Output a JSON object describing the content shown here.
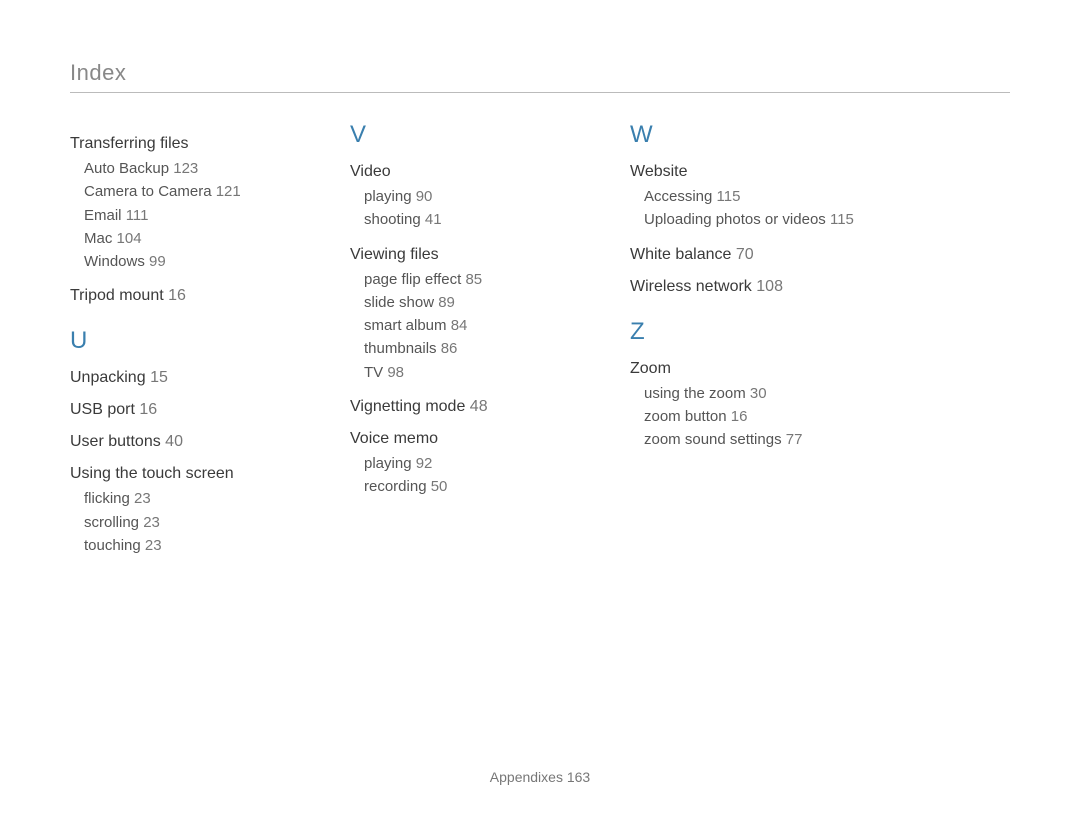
{
  "header": "Index",
  "col1": {
    "transferring": {
      "title": "Transferring files",
      "items": [
        {
          "label": "Auto Backup",
          "page": "123"
        },
        {
          "label": "Camera to Camera",
          "page": "121"
        },
        {
          "label": "Email",
          "page": "111"
        },
        {
          "label": "Mac",
          "page": "104"
        },
        {
          "label": "Windows",
          "page": "99"
        }
      ]
    },
    "tripod": {
      "label": "Tripod mount",
      "page": "16"
    },
    "letter": "U",
    "unpacking": {
      "label": "Unpacking",
      "page": "15"
    },
    "usbport": {
      "label": "USB port",
      "page": "16"
    },
    "userbuttons": {
      "label": "User buttons",
      "page": "40"
    },
    "touchscreen": {
      "title": "Using the touch screen",
      "items": [
        {
          "label": "flicking",
          "page": "23"
        },
        {
          "label": "scrolling",
          "page": "23"
        },
        {
          "label": "touching",
          "page": "23"
        }
      ]
    }
  },
  "col2": {
    "letter": "V",
    "video": {
      "title": "Video",
      "items": [
        {
          "label": "playing",
          "page": "90"
        },
        {
          "label": "shooting",
          "page": "41"
        }
      ]
    },
    "viewing": {
      "title": "Viewing files",
      "items": [
        {
          "label": "page flip effect",
          "page": "85"
        },
        {
          "label": "slide show",
          "page": "89"
        },
        {
          "label": "smart album",
          "page": "84"
        },
        {
          "label": "thumbnails",
          "page": "86"
        },
        {
          "label": "TV",
          "page": "98"
        }
      ]
    },
    "vignetting": {
      "label": "Vignetting mode",
      "page": "48"
    },
    "voice": {
      "title": "Voice memo",
      "items": [
        {
          "label": "playing",
          "page": "92"
        },
        {
          "label": "recording",
          "page": "50"
        }
      ]
    }
  },
  "col3": {
    "letterW": "W",
    "website": {
      "title": "Website",
      "items": [
        {
          "label": "Accessing",
          "page": "115"
        },
        {
          "label": "Uploading photos or videos",
          "page": "115"
        }
      ]
    },
    "whitebalance": {
      "label": "White balance",
      "page": "70"
    },
    "wireless": {
      "label": "Wireless network",
      "page": "108"
    },
    "letterZ": "Z",
    "zoom": {
      "title": "Zoom",
      "items": [
        {
          "label": "using the zoom",
          "page": "30"
        },
        {
          "label": "zoom button",
          "page": "16"
        },
        {
          "label": "zoom sound settings",
          "page": "77"
        }
      ]
    }
  },
  "footer": {
    "section": "Appendixes",
    "page": "163"
  }
}
